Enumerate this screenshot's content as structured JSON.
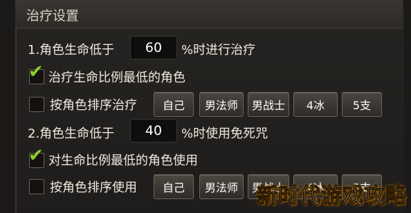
{
  "panel": {
    "title": "治疗设置"
  },
  "section1": {
    "label_before": "1.角色生命低于",
    "value": "60",
    "label_after": "%时进行治疗",
    "option_lowest": {
      "checked": true,
      "label": "治疗生命比例最低的角色"
    },
    "option_order": {
      "checked": false,
      "label": "按角色排序治疗"
    },
    "order_buttons": [
      "自己",
      "男法师",
      "男战士",
      "4冰",
      "5支"
    ]
  },
  "section2": {
    "label_before": "2.角色生命低于",
    "value": "40",
    "label_after": "%时使用免死咒",
    "option_lowest": {
      "checked": true,
      "label": "对生命比例最低的角色使用"
    },
    "option_order": {
      "checked": false,
      "label": "按角色排序使用"
    },
    "order_buttons": [
      "自己",
      "男法师",
      "男战士",
      "4冰",
      "5支"
    ]
  },
  "watermark": "新时代游戏攻略"
}
